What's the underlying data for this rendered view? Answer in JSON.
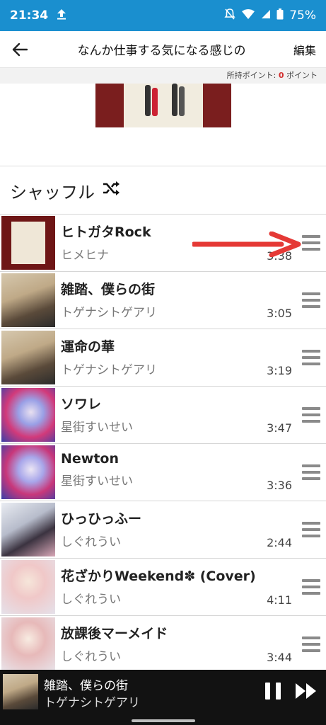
{
  "status": {
    "time": "21:34",
    "battery": "75%"
  },
  "header": {
    "title": "なんか仕事する気になる感じの",
    "edit_label": "編集"
  },
  "points": {
    "label": "所持ポイント: ",
    "value": "0",
    "unit": " ポイント"
  },
  "shuffle": {
    "label": "シャッフル",
    "icon": "shuffle-icon"
  },
  "songs": [
    {
      "title": "ヒトガタRock",
      "artist": "ヒメヒナ",
      "duration": "3:38",
      "thumb": "#6e1616"
    },
    {
      "title": "雑踏、僕らの街",
      "artist": "トゲナシトゲアリ",
      "duration": "3:05",
      "thumb": "#c9b79a"
    },
    {
      "title": "運命の華",
      "artist": "トゲナシトゲアリ",
      "duration": "3:19",
      "thumb": "#c9b79a"
    },
    {
      "title": "ソワレ",
      "artist": "星街すいせい",
      "duration": "3:47",
      "thumb": "#5b5fc7"
    },
    {
      "title": "Newton",
      "artist": "星街すいせい",
      "duration": "3:36",
      "thumb": "#6a6ad0"
    },
    {
      "title": "ひっひっふー",
      "artist": "しぐれうい",
      "duration": "2:44",
      "thumb": "#d8dbe3"
    },
    {
      "title": "花ざかりWeekend✽ (Cover)",
      "artist": "しぐれうい",
      "duration": "4:11",
      "thumb": "#eadfd8"
    },
    {
      "title": "放課後マーメイド",
      "artist": "しぐれうい",
      "duration": "3:44",
      "thumb": "#e9e2dc"
    }
  ],
  "now_playing": {
    "title": "雑踏、僕らの街",
    "artist": "トゲナシトゲアリ"
  },
  "colors": {
    "status_bar": "#1a8fcf",
    "points_accent": "#d32f2f",
    "arrow": "#e53935"
  }
}
